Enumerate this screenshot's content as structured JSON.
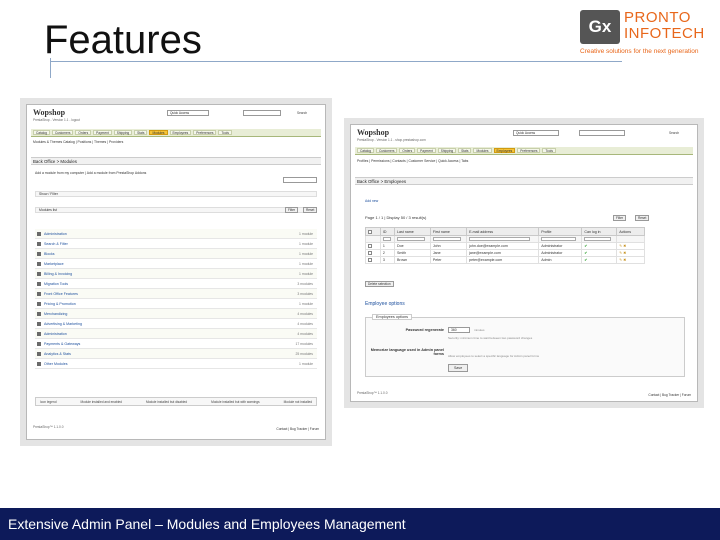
{
  "slide": {
    "title": "Features",
    "footer": "Extensive Admin Panel – Modules and Employees Management",
    "logo": {
      "mark": "Gx",
      "name_line1": "PRONTO",
      "name_line2": "INFOTECH",
      "tagline": "Creative solutions for the next generation"
    }
  },
  "colors": {
    "footer_bg": "#0d1a5a",
    "logo_orange": "#e8671b",
    "active_tab": "#f6c437",
    "link_blue": "#1a4d9c"
  },
  "modules_screen": {
    "brand": "Wopshop",
    "crumb": "PrestaShop - Version 1.1 - logout",
    "quick_access": "Quick Access",
    "search_btn": "Search",
    "tabs": [
      "Catalog",
      "Customers",
      "Orders",
      "Payment",
      "Shipping",
      "Stats",
      "Modules",
      "Employees",
      "Preferences",
      "Tools"
    ],
    "active_tab": "Modules",
    "subnav": "Modules & Themes Catalog | Positions | Themes | Providers",
    "header": "Back Office > Modules",
    "info_line": "Add a module from my computer | Add a module from PrestaShop Addons",
    "filter_label": "Show / Filter",
    "search_label": "Search",
    "all_modules": "Modules list",
    "filter_btn": "Filter",
    "reset_btn": "Reset",
    "modules": [
      {
        "name": "Administration",
        "count": "1 module"
      },
      {
        "name": "Search & Filter",
        "count": "1 module"
      },
      {
        "name": "Blocks",
        "count": "1 module"
      },
      {
        "name": "Marketplace",
        "count": "1 module"
      },
      {
        "name": "Billing & Invoicing",
        "count": "1 module"
      },
      {
        "name": "Migration Tools",
        "count": "3 modules"
      },
      {
        "name": "Front Office Features",
        "count": "3 modules"
      },
      {
        "name": "Pricing & Promotion",
        "count": "1 module"
      },
      {
        "name": "Merchandizing",
        "count": "4 modules"
      },
      {
        "name": "Advertising & Marketing",
        "count": "4 modules"
      },
      {
        "name": "Administration",
        "count": "4 modules"
      },
      {
        "name": "Payments & Gateways",
        "count": "17 modules"
      },
      {
        "name": "Analytics & Stats",
        "count": "25 modules"
      },
      {
        "name": "Other Modules",
        "count": "1 module"
      }
    ],
    "legend": [
      "Icon legend",
      "Module installed and enabled",
      "Module installed but disabled",
      "Module installed but with warnings",
      "Module not installed"
    ],
    "footer_left": "PrestaShop™ 1.1.0.0",
    "footer_right": "Contact | Bug Tracker | Forum"
  },
  "employees_screen": {
    "brand": "Wopshop",
    "crumb": "PrestaShop - Version 1.1 - shop.prestashop.com",
    "quick_access": "Quick Access",
    "search_btn": "Search",
    "tabs": [
      "Catalog",
      "Customers",
      "Orders",
      "Payment",
      "Shipping",
      "Stats",
      "Modules",
      "Employees",
      "Preferences",
      "Tools"
    ],
    "active_tab": "Employees",
    "subnav": "Profiles | Permissions | Contacts | Customer Service | Quick Access | Tabs",
    "header": "Back Office > Employees",
    "add_new": "Add new",
    "pagination": "Page 1 / 1 | Display 50 / 3 result(s)",
    "filter_btn": "Filter",
    "reset_btn": "Reset",
    "columns": [
      "ID",
      "Last name",
      "First name",
      "E-mail address",
      "Profile",
      "Can log in",
      "Actions"
    ],
    "rows": [
      {
        "id": "1",
        "last": "Doe",
        "first": "John",
        "email": "john.doe@example.com",
        "profile": "Administrator"
      },
      {
        "id": "2",
        "last": "Smith",
        "first": "Jane",
        "email": "jane@example.com",
        "profile": "Administrator"
      },
      {
        "id": "3",
        "last": "Brown",
        "first": "Peter",
        "email": "peter@example.com",
        "profile": "Admin"
      }
    ],
    "delete_selection": "Delete selection",
    "options_title": "Employee options",
    "fieldset_legend": "Employees options",
    "pw_label": "Password regenerate",
    "pw_value": "360",
    "pw_unit": "minutes",
    "pw_help": "Security: minimum time to wait between two password changes",
    "lang_label": "Memorize language used in Admin panel forms",
    "lang_help": "Allow employees to select a specific language for Admin panel forms",
    "save_btn": "Save",
    "footer_left": "PrestaShop™ 1.1.0.0",
    "footer_right": "Contact | Bug Tracker | Forum"
  }
}
